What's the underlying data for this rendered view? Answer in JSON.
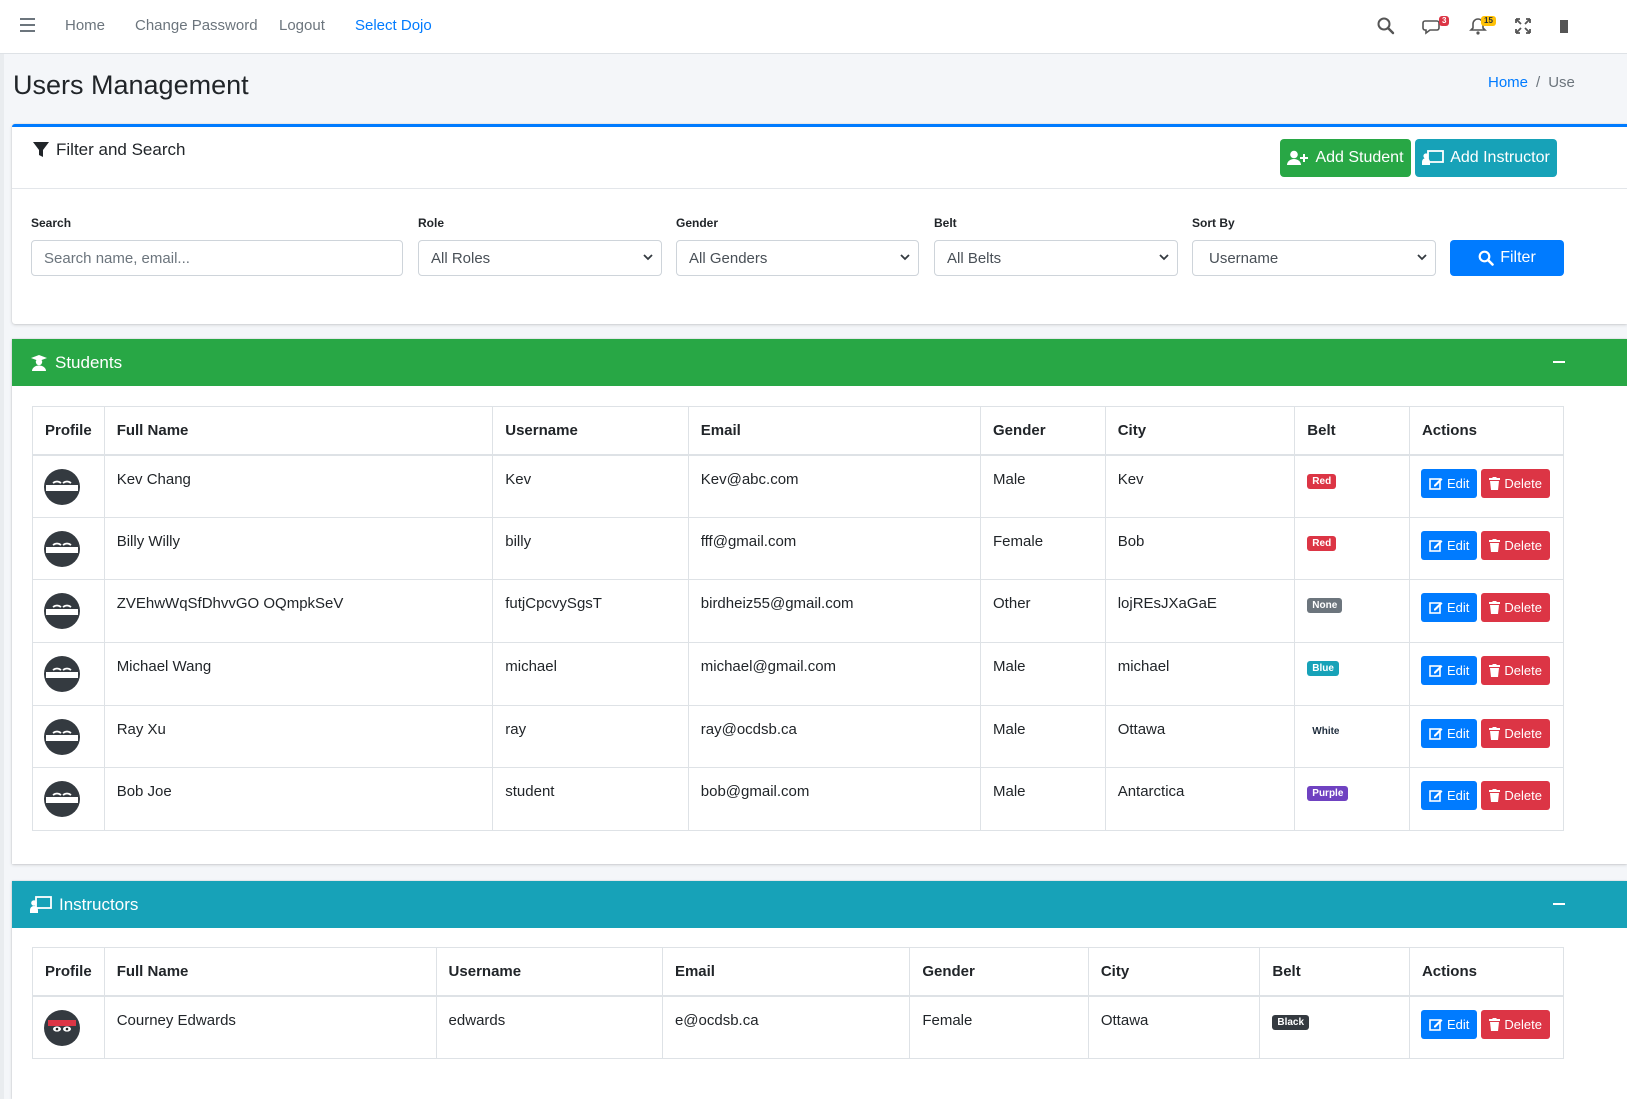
{
  "nav": {
    "links": [
      "Home",
      "Change Password",
      "Logout",
      "Select Dojo"
    ],
    "messages_count": "3",
    "notifications_count": "15"
  },
  "header": {
    "title": "Users Management",
    "breadcrumb_home": "Home",
    "breadcrumb_current": "Use"
  },
  "filter": {
    "title": "Filter and Search",
    "add_student_label": "Add Student",
    "add_instructor_label": "Add Instructor",
    "search_label": "Search",
    "search_placeholder": "Search name, email...",
    "role_label": "Role",
    "role_value": "All Roles",
    "gender_label": "Gender",
    "gender_value": "All Genders",
    "belt_label": "Belt",
    "belt_value": "All Belts",
    "sort_label": "Sort By",
    "sort_value": "Username",
    "filter_button": "Filter"
  },
  "students": {
    "title": "Students",
    "headers": [
      "Profile",
      "Full Name",
      "Username",
      "Email",
      "Gender",
      "City",
      "Belt",
      "Actions"
    ],
    "rows": [
      {
        "full_name": "Kev Chang",
        "username": "Kev",
        "email": "Kev@abc.com",
        "gender": "Male",
        "city": "Kev",
        "belt": "Red"
      },
      {
        "full_name": "Billy Willy",
        "username": "billy",
        "email": "fff@gmail.com",
        "gender": "Female",
        "city": "Bob",
        "belt": "Red"
      },
      {
        "full_name": "ZVEhwWqSfDhvvGO OQmpkSeV",
        "username": "futjCpcvySgsT",
        "email": "birdheiz55@gmail.com",
        "gender": "Other",
        "city": "lojREsJXaGaE",
        "belt": "None"
      },
      {
        "full_name": "Michael Wang",
        "username": "michael",
        "email": "michael@gmail.com",
        "gender": "Male",
        "city": "michael",
        "belt": "Blue"
      },
      {
        "full_name": "Ray Xu",
        "username": "ray",
        "email": "ray@ocdsb.ca",
        "gender": "Male",
        "city": "Ottawa",
        "belt": "White"
      },
      {
        "full_name": "Bob Joe",
        "username": "student",
        "email": "bob@gmail.com",
        "gender": "Male",
        "city": "Antarctica",
        "belt": "Purple"
      }
    ]
  },
  "instructors": {
    "title": "Instructors",
    "headers": [
      "Profile",
      "Full Name",
      "Username",
      "Email",
      "Gender",
      "City",
      "Belt",
      "Actions"
    ],
    "rows": [
      {
        "full_name": "Courney Edwards",
        "username": "edwards",
        "email": "e@ocdsb.ca",
        "gender": "Female",
        "city": "Ottawa",
        "belt": "Black"
      }
    ]
  },
  "actions": {
    "edit_label": "Edit",
    "delete_label": "Delete"
  },
  "colors": {
    "primary": "#007bff",
    "success": "#28a745",
    "info": "#17a2b8",
    "danger": "#dc3545",
    "secondary": "#6c757d",
    "purple": "#6f42c1",
    "dark": "#343a40",
    "warning": "#ffc107"
  }
}
